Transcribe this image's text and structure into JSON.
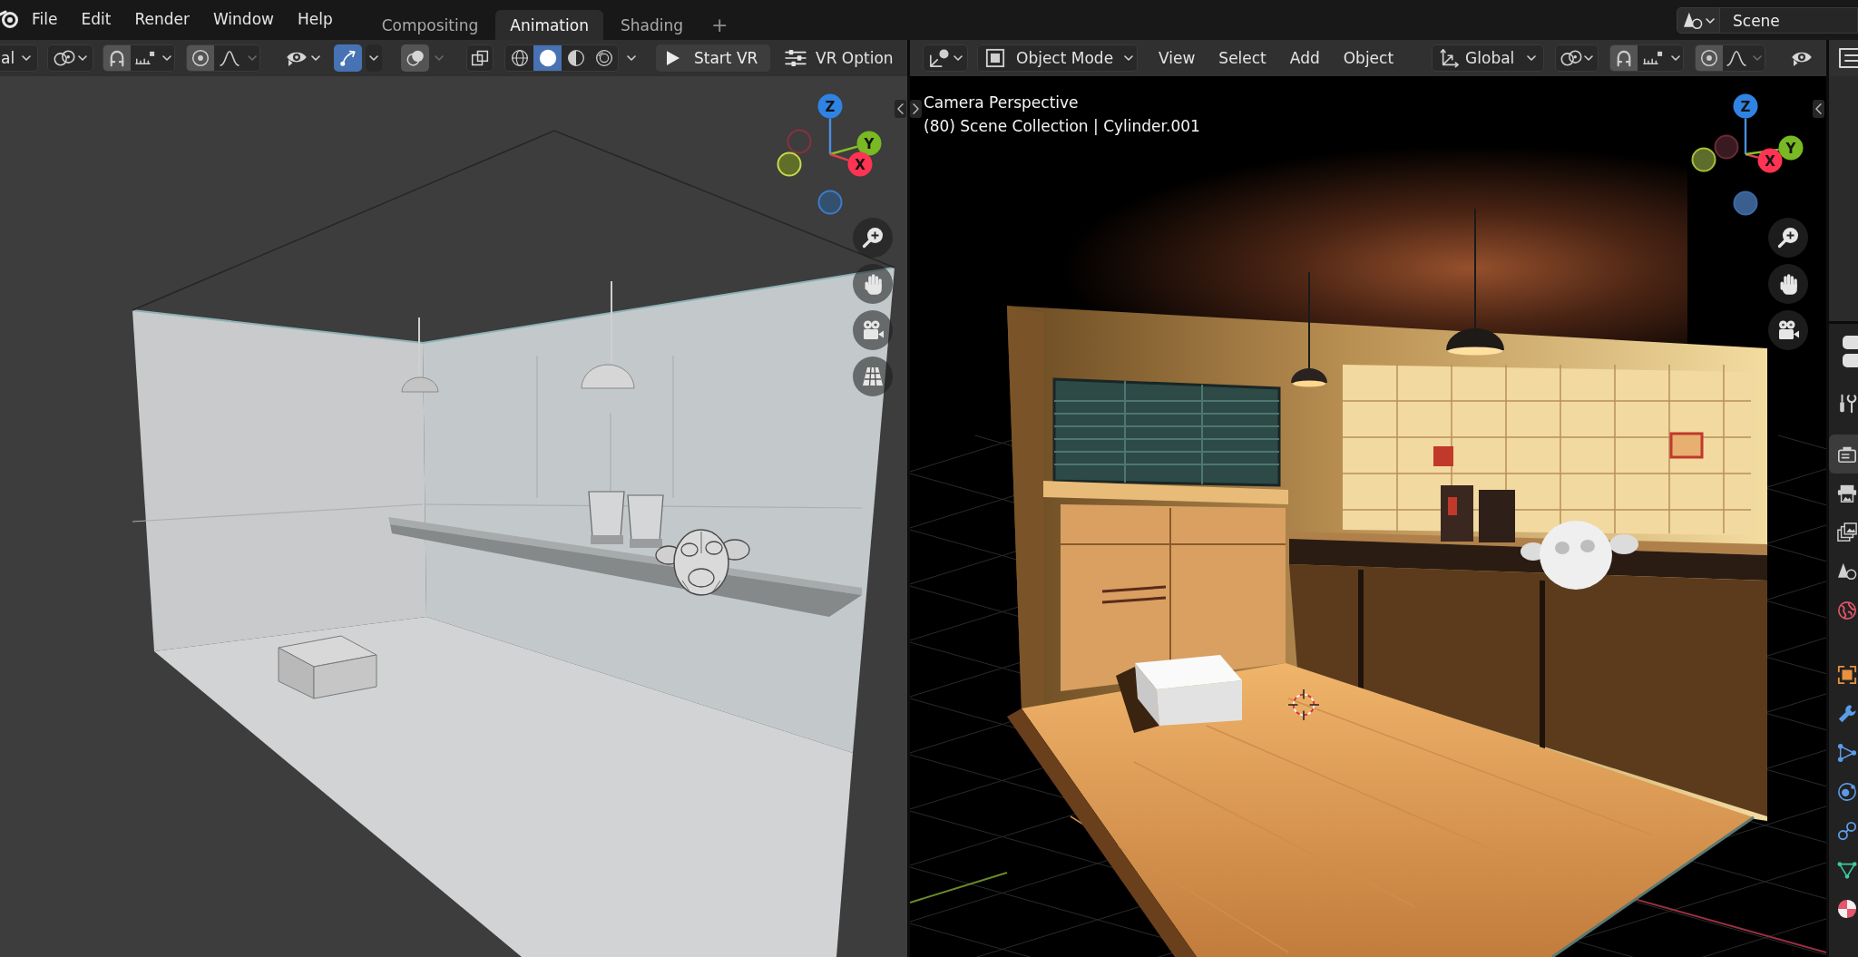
{
  "top_bar": {
    "menus": [
      "File",
      "Edit",
      "Render",
      "Window",
      "Help"
    ],
    "workspaces": [
      {
        "label": "Compositing",
        "selected": false
      },
      {
        "label": "Animation",
        "selected": true
      },
      {
        "label": "Shading",
        "selected": false
      }
    ],
    "add_workspace": "+",
    "scene": "Scene"
  },
  "left_viewport": {
    "header": {
      "orientation": "al",
      "snapping": {
        "on": true
      },
      "proportional_editing": {
        "on": true
      },
      "gizmos": {
        "on": true
      },
      "overlays": {
        "on": true
      },
      "xray": {
        "on": false
      },
      "shading_modes": [
        {
          "selected": false
        },
        {
          "selected": true
        },
        {
          "selected": false
        },
        {
          "selected": false
        }
      ],
      "start_vr": "Start VR",
      "vr_options": "VR Option"
    },
    "gizmo_axes": [
      "Z",
      "Y",
      "X"
    ]
  },
  "right_viewport": {
    "header": {
      "mode": "Object Mode",
      "menus": [
        "View",
        "Select",
        "Add",
        "Object"
      ],
      "orientation": "Global",
      "snapping": {
        "on": true
      },
      "proportional_editing": {
        "on": true
      }
    },
    "view_name": "Camera Perspective",
    "collection_info": "(80) Scene Collection | Cylinder.001",
    "gizmo_axes": [
      "Z",
      "X",
      "Y"
    ]
  },
  "properties_tabs": [
    {
      "selected": false
    },
    {
      "selected": true
    },
    {
      "selected": false
    },
    {
      "selected": false
    },
    {
      "selected": false
    },
    {
      "selected": false
    },
    {
      "selected": false
    },
    {
      "selected": false
    },
    {
      "selected": false
    },
    {
      "selected": false
    },
    {
      "selected": false
    },
    {
      "selected": false
    },
    {
      "selected": false
    }
  ]
}
